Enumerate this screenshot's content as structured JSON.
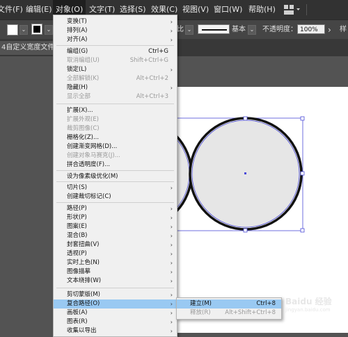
{
  "menubar": {
    "items": [
      {
        "label": "文件(F)"
      },
      {
        "label": "编辑(E)"
      },
      {
        "label": "对象(O)"
      },
      {
        "label": "文字(T)"
      },
      {
        "label": "选择(S)"
      },
      {
        "label": "效果(C)"
      },
      {
        "label": "视图(V)"
      },
      {
        "label": "窗口(W)"
      },
      {
        "label": "帮助(H)"
      }
    ],
    "workspace_icon": "grid-layout-icon"
  },
  "control_bar": {
    "partial_label_left": "比",
    "stroke_profile_label": "基本",
    "opacity_label": "不透明度：",
    "opacity_value": "100%",
    "style_label": "样"
  },
  "document_tab": {
    "title": "4自定义宽度文件"
  },
  "object_menu": {
    "items": [
      {
        "label": "变换(T)",
        "shortcut": "",
        "submenu": true,
        "disabled": false
      },
      {
        "label": "排列(A)",
        "shortcut": "",
        "submenu": true,
        "disabled": false
      },
      {
        "label": "对齐(A)",
        "shortcut": "",
        "submenu": true,
        "disabled": false
      },
      {
        "label": "编组(G)",
        "shortcut": "Ctrl+G",
        "submenu": false,
        "disabled": false
      },
      {
        "label": "取消编组(U)",
        "shortcut": "Shift+Ctrl+G",
        "submenu": false,
        "disabled": true
      },
      {
        "label": "锁定(L)",
        "shortcut": "",
        "submenu": true,
        "disabled": false
      },
      {
        "label": "全部解锁(K)",
        "shortcut": "Alt+Ctrl+2",
        "submenu": false,
        "disabled": true
      },
      {
        "label": "隐藏(H)",
        "shortcut": "",
        "submenu": true,
        "disabled": false
      },
      {
        "label": "显示全部",
        "shortcut": "Alt+Ctrl+3",
        "submenu": false,
        "disabled": true
      },
      {
        "label": "扩展(X)...",
        "shortcut": "",
        "submenu": false,
        "disabled": false
      },
      {
        "label": "扩展外观(E)",
        "shortcut": "",
        "submenu": false,
        "disabled": true
      },
      {
        "label": "裁剪图像(C)",
        "shortcut": "",
        "submenu": false,
        "disabled": true
      },
      {
        "label": "栅格化(Z)...",
        "shortcut": "",
        "submenu": false,
        "disabled": false
      },
      {
        "label": "创建渐变网格(D)...",
        "shortcut": "",
        "submenu": false,
        "disabled": false
      },
      {
        "label": "创建对象马赛克(J)...",
        "shortcut": "",
        "submenu": false,
        "disabled": true
      },
      {
        "label": "拼合透明度(F)...",
        "shortcut": "",
        "submenu": false,
        "disabled": false
      },
      {
        "label": "设为像素级优化(M)",
        "shortcut": "",
        "submenu": false,
        "disabled": false
      },
      {
        "label": "切片(S)",
        "shortcut": "",
        "submenu": true,
        "disabled": false
      },
      {
        "label": "创建裁切标记(C)",
        "shortcut": "",
        "submenu": false,
        "disabled": false
      },
      {
        "label": "路径(P)",
        "shortcut": "",
        "submenu": true,
        "disabled": false
      },
      {
        "label": "形状(P)",
        "shortcut": "",
        "submenu": true,
        "disabled": false
      },
      {
        "label": "图案(E)",
        "shortcut": "",
        "submenu": true,
        "disabled": false
      },
      {
        "label": "混合(B)",
        "shortcut": "",
        "submenu": true,
        "disabled": false
      },
      {
        "label": "封套扭曲(V)",
        "shortcut": "",
        "submenu": true,
        "disabled": false
      },
      {
        "label": "透视(P)",
        "shortcut": "",
        "submenu": true,
        "disabled": false
      },
      {
        "label": "实时上色(N)",
        "shortcut": "",
        "submenu": true,
        "disabled": false
      },
      {
        "label": "图像描摹",
        "shortcut": "",
        "submenu": true,
        "disabled": false
      },
      {
        "label": "文本绕排(W)",
        "shortcut": "",
        "submenu": true,
        "disabled": false
      },
      {
        "label": "剪切蒙版(M)",
        "shortcut": "",
        "submenu": true,
        "disabled": false
      },
      {
        "label": "复合路径(O)",
        "shortcut": "",
        "submenu": true,
        "disabled": false,
        "highlighted": true
      },
      {
        "label": "画板(A)",
        "shortcut": "",
        "submenu": true,
        "disabled": false
      },
      {
        "label": "图表(R)",
        "shortcut": "",
        "submenu": true,
        "disabled": false
      },
      {
        "label": "收集以导出",
        "shortcut": "",
        "submenu": true,
        "disabled": false
      }
    ]
  },
  "compound_path_submenu": {
    "items": [
      {
        "label": "建立(M)",
        "shortcut": "Ctrl+8",
        "disabled": false,
        "highlighted": true
      },
      {
        "label": "释放(R)",
        "shortcut": "Alt+Shift+Ctrl+8",
        "disabled": true
      }
    ]
  },
  "watermark": {
    "text": "Baidu 经验",
    "sub": "jingyan.baidu.com"
  },
  "colors": {
    "menu_bg": "#f0f0f0",
    "highlight": "#99c9f2",
    "circle_fill": "#e6e6e6",
    "circle_stroke": "#111111",
    "selection": "#4b4bd8"
  }
}
